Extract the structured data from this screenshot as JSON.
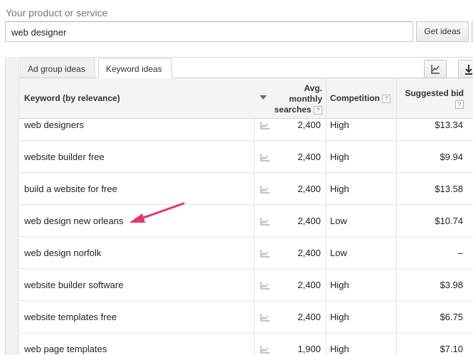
{
  "search": {
    "label": "Your product or service",
    "value": "web designer",
    "button": "Get ideas"
  },
  "tabs": [
    {
      "label": "Ad group ideas",
      "active": false
    },
    {
      "label": "Keyword ideas",
      "active": true
    }
  ],
  "toolbar": {
    "chart_icon": "line-chart-icon",
    "download_icon": "download-icon"
  },
  "table": {
    "headers": {
      "keyword": "Keyword (by relevance)",
      "avg_line1": "Avg.",
      "avg_line2": "monthly",
      "avg_line3": "searches",
      "competition": "Competition",
      "bid_line1": "Suggested bid",
      "help": "?"
    },
    "rows": [
      {
        "keyword": "web designers",
        "avg": "2,400",
        "competition": "High",
        "bid": "$13.34"
      },
      {
        "keyword": "website builder free",
        "avg": "2,400",
        "competition": "High",
        "bid": "$9.94"
      },
      {
        "keyword": "build a website for free",
        "avg": "2,400",
        "competition": "High",
        "bid": "$13.58"
      },
      {
        "keyword": "web design new orleans",
        "avg": "2,400",
        "competition": "Low",
        "bid": "$10.74"
      },
      {
        "keyword": "web design norfolk",
        "avg": "2,400",
        "competition": "Low",
        "bid": "–"
      },
      {
        "keyword": "website builder software",
        "avg": "2,400",
        "competition": "High",
        "bid": "$3.98"
      },
      {
        "keyword": "website templates free",
        "avg": "2,400",
        "competition": "High",
        "bid": "$6.75"
      },
      {
        "keyword": "web page templates",
        "avg": "1,900",
        "competition": "High",
        "bid": "$7.10"
      }
    ]
  },
  "annotation": {
    "color": "#e8336b",
    "icon": "pointer-arrow"
  }
}
